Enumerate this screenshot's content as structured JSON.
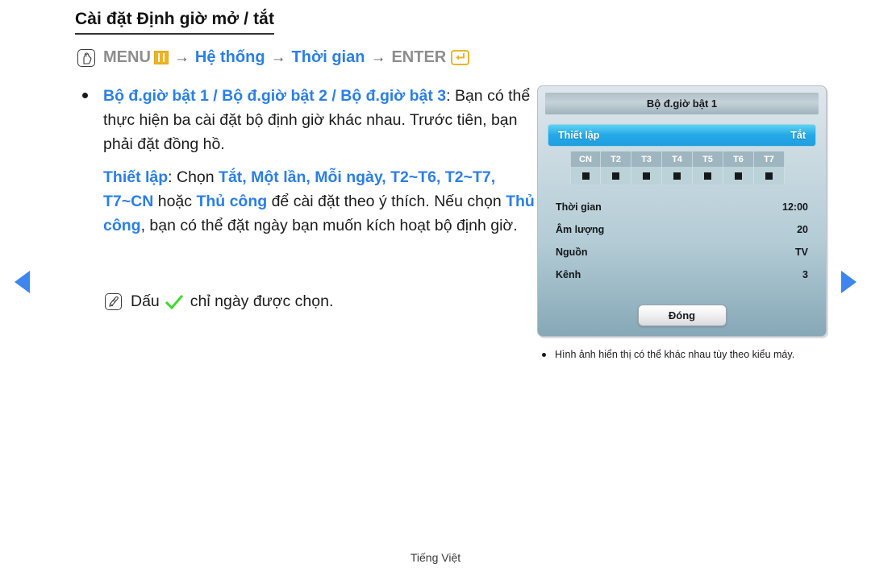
{
  "page": {
    "title": "Cài đặt Định giờ mở / tắt",
    "footer": "Tiếng Việt"
  },
  "menu_path": {
    "remote_icon": "remote-hand-icon",
    "menu_label": "MENU",
    "menu_glyph": "menu-bars-icon",
    "arrow": "→",
    "step1": "Hệ thống",
    "step2": "Thời gian",
    "enter_label": "ENTER",
    "enter_glyph": "enter-return-icon"
  },
  "body": {
    "bullet1": {
      "heading": "Bộ đ.giờ bật 1 / Bộ đ.giờ bật 2 / Bộ đ.giờ bật 3",
      "colon": ":",
      "text": "Bạn có thể thực hiện ba cài đặt bộ định giờ khác nhau. Trước tiên, bạn phải đặt đồng hồ."
    },
    "bullet2": {
      "label": "Thiết lập",
      "t1": ": Chọn ",
      "hl1": "Tắt, Một lần, Mỗi ngày, T2~T6, T2~T7, T7~CN",
      "t2": " hoặc ",
      "hl2": "Thủ công",
      "t3": " để cài đặt theo ý thích. Nếu chọn ",
      "hl3": "Thủ công",
      "t4": ", bạn có thể đặt ngày bạn muốn kích hoạt bộ định giờ."
    },
    "note": {
      "icon": "note-pen-icon",
      "prefix": "Dấu",
      "check_icon": "green-check-icon",
      "suffix": "chỉ ngày được chọn."
    }
  },
  "nav": {
    "prev": "previous-page-arrow",
    "next": "next-page-arrow"
  },
  "osd": {
    "title": "Bộ đ.giờ bật 1",
    "highlight_row": {
      "label": "Thiết lập",
      "value": "Tắt"
    },
    "days": [
      {
        "label": "CN",
        "checked": true
      },
      {
        "label": "T2",
        "checked": true
      },
      {
        "label": "T3",
        "checked": true
      },
      {
        "label": "T4",
        "checked": true
      },
      {
        "label": "T5",
        "checked": true
      },
      {
        "label": "T6",
        "checked": true
      },
      {
        "label": "T7",
        "checked": true
      }
    ],
    "fields": [
      {
        "label": "Thời gian",
        "value": "12:00"
      },
      {
        "label": "Âm lượng",
        "value": "20"
      },
      {
        "label": "Nguồn",
        "value": "TV"
      },
      {
        "label": "Kênh",
        "value": "3"
      }
    ],
    "close_button": "Đóng",
    "caption": "Hình ảnh hiển thị có thể khác nhau tùy theo kiểu máy."
  },
  "colors": {
    "accent_blue": "#2a7fe8",
    "menu_yellow": "#f0b323",
    "osd_highlight": "#25a9e8",
    "check_green": "#3ddc2a"
  }
}
